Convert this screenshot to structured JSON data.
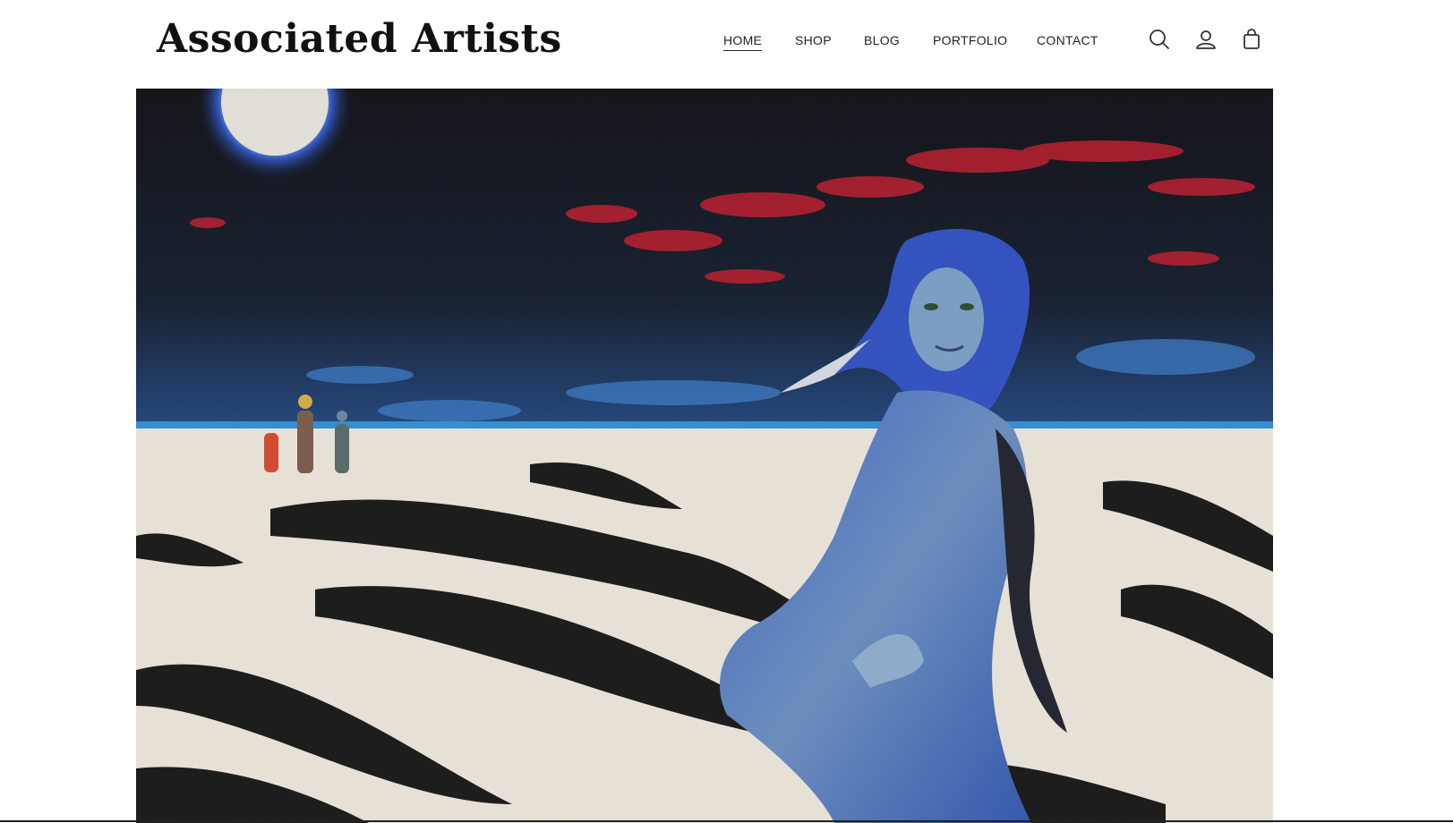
{
  "site": {
    "logo": "Associated Artists"
  },
  "nav": {
    "items": [
      {
        "label": "HOME",
        "active": true
      },
      {
        "label": "SHOP",
        "active": false
      },
      {
        "label": "BLOG",
        "active": false
      },
      {
        "label": "PORTFOLIO",
        "active": false
      },
      {
        "label": "CONTACT",
        "active": false
      }
    ]
  },
  "header_icons": [
    "search-icon",
    "account-icon",
    "cart-icon"
  ],
  "hero": {
    "image": "sand-painting of a blue-haired woman on a snowy shore under a night sky with a moon"
  },
  "colors": {
    "text": "#222222",
    "background": "#ffffff"
  }
}
